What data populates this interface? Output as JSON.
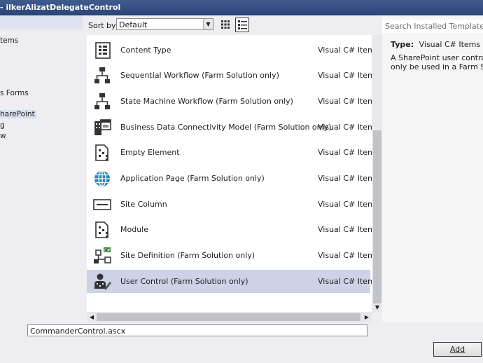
{
  "window": {
    "title": "- ilkerAlizatDelegateControl"
  },
  "sidebar": {
    "items": [
      {
        "label": "tems",
        "selected": false
      },
      {
        "label": "s Forms",
        "selected": false
      },
      {
        "label": "harePoint",
        "selected": true
      },
      {
        "label": "g",
        "selected": false
      },
      {
        "label": "w",
        "selected": false
      }
    ]
  },
  "toolbar": {
    "sort_label": "Sort by:",
    "sort_value": "Default",
    "view_small_icons": "small-icons-view-icon",
    "view_list": "list-view-icon"
  },
  "templates": [
    {
      "name": "Content Type",
      "category": "Visual C# Items",
      "icon": "content-type-icon"
    },
    {
      "name": "Sequential Workflow (Farm Solution only)",
      "category": "Visual C# Items",
      "icon": "workflow-icon"
    },
    {
      "name": "State Machine Workflow (Farm Solution only)",
      "category": "Visual C# Items",
      "icon": "workflow-icon"
    },
    {
      "name": "Business Data Connectivity Model (Farm Solution only)",
      "category": "Visual C# Items",
      "icon": "bdc-model-icon"
    },
    {
      "name": "Empty Element",
      "category": "Visual C# Items",
      "icon": "element-icon"
    },
    {
      "name": "Application Page (Farm Solution only)",
      "category": "Visual C# Items",
      "icon": "globe-icon"
    },
    {
      "name": "Site Column",
      "category": "Visual C# Items",
      "icon": "site-column-icon"
    },
    {
      "name": "Module",
      "category": "Visual C# Items",
      "icon": "module-icon"
    },
    {
      "name": "Site Definition (Farm Solution only)",
      "category": "Visual C# Items",
      "icon": "site-definition-icon"
    },
    {
      "name": "User Control (Farm Solution only)",
      "category": "Visual C# Items",
      "icon": "user-control-icon",
      "selected": true
    }
  ],
  "details": {
    "search_placeholder": "Search Installed Templates",
    "type_label": "Type:",
    "type_value": "Visual C# Items",
    "description_line1": "A SharePoint user control item.",
    "description_line2": "only be used in a Farm Solution"
  },
  "name_field": {
    "value": "CommanderControl.ascx"
  },
  "buttons": {
    "add": "Add"
  },
  "colors": {
    "titlebar": "#2f4a7c",
    "selection": "#cdd2e6",
    "accent_blue": "#1e88c8"
  }
}
